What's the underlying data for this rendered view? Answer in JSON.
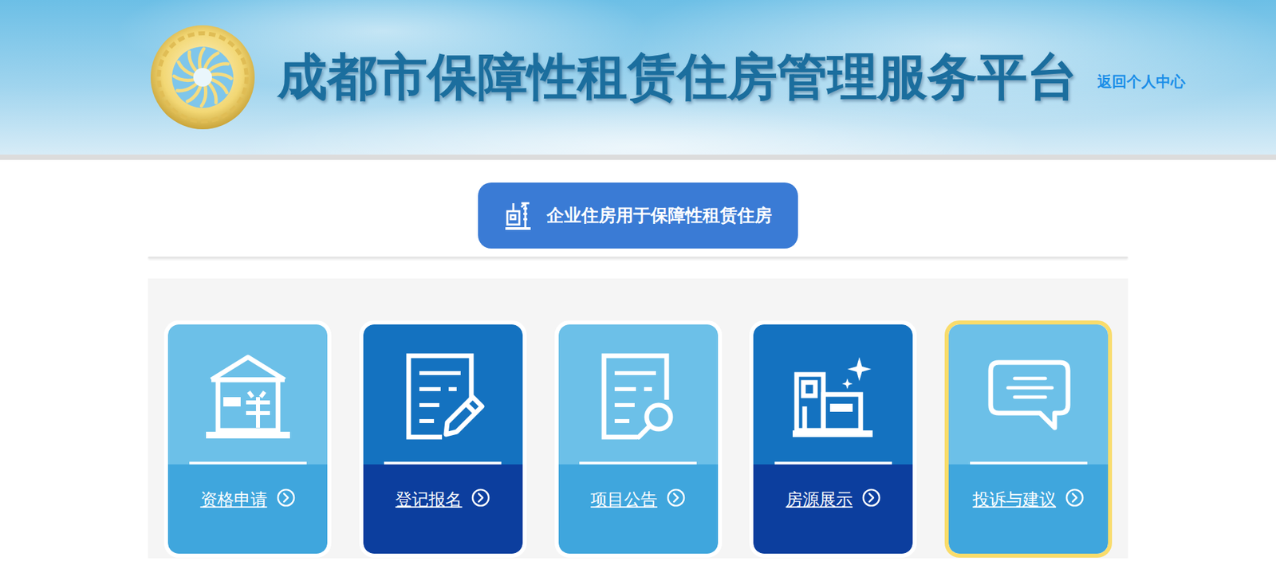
{
  "header": {
    "title": "成都市保障性租赁住房管理服务平台",
    "back_link": "返回个人中心"
  },
  "tab": {
    "label": "企业住房用于保障性租赁住房"
  },
  "cards": [
    {
      "label": "资格申请",
      "icon": "house",
      "selected": false
    },
    {
      "label": "登记报名",
      "icon": "form-edit",
      "selected": false
    },
    {
      "label": "项目公告",
      "icon": "form-search",
      "selected": false
    },
    {
      "label": "房源展示",
      "icon": "building",
      "selected": false
    },
    {
      "label": "投诉与建议",
      "icon": "chat",
      "selected": true
    }
  ]
}
